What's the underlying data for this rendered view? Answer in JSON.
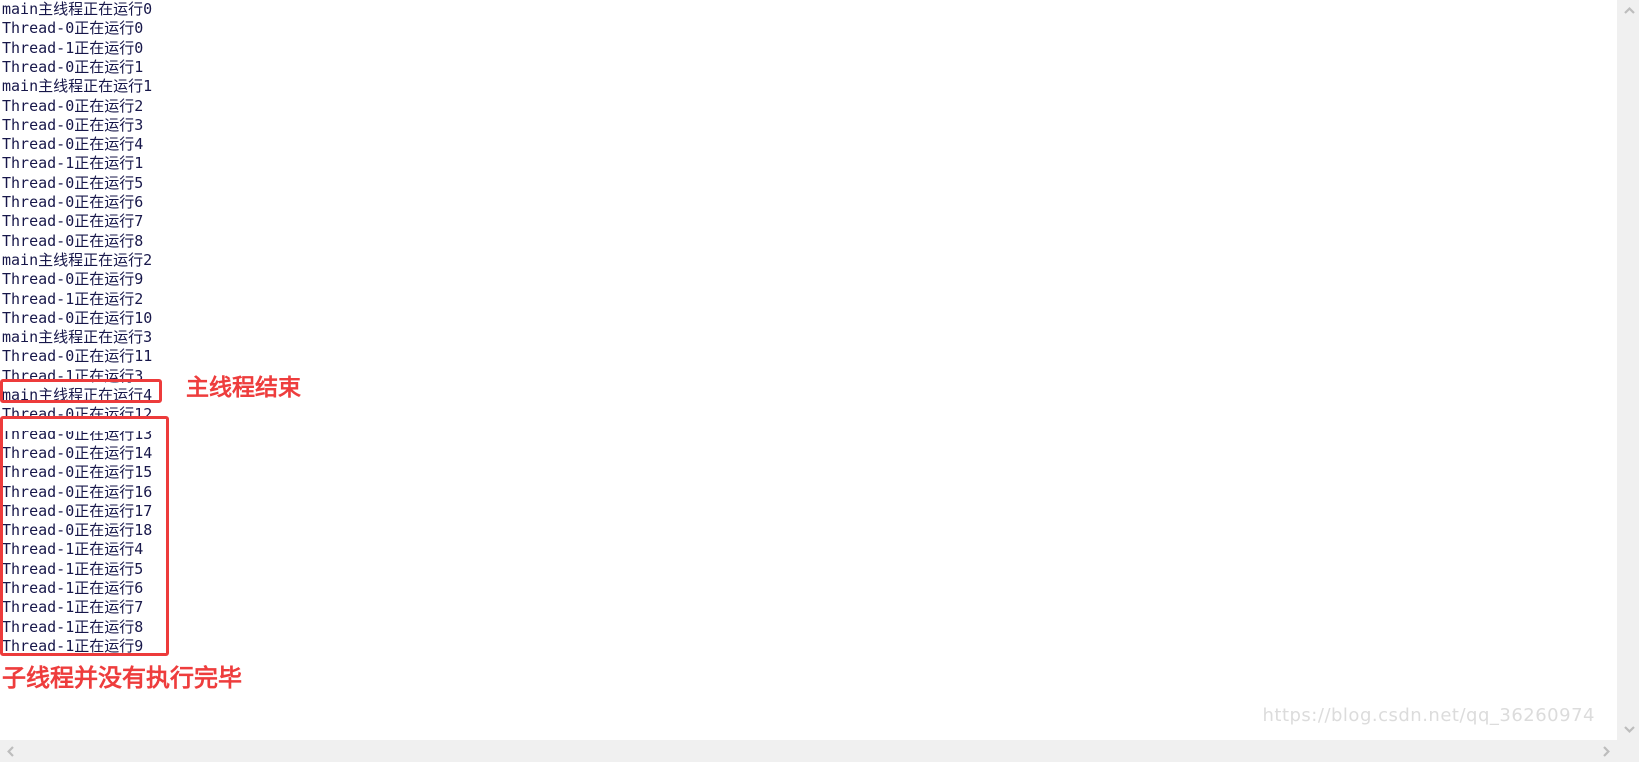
{
  "colors": {
    "background": "#ffffff",
    "log_text": "#17174a",
    "annotation_red": "#ee3d3d",
    "box_red": "#ed3b3b",
    "scrollbar_track": "#f0f0f0",
    "scrollbar_arrow": "#bdbdbd",
    "watermark": "#dcdcdc"
  },
  "console": {
    "lines": [
      "main主线程正在运行0",
      "Thread-0正在运行0",
      "Thread-1正在运行0",
      "Thread-0正在运行1",
      "main主线程正在运行1",
      "Thread-0正在运行2",
      "Thread-0正在运行3",
      "Thread-0正在运行4",
      "Thread-1正在运行1",
      "Thread-0正在运行5",
      "Thread-0正在运行6",
      "Thread-0正在运行7",
      "Thread-0正在运行8",
      "main主线程正在运行2",
      "Thread-0正在运行9",
      "Thread-1正在运行2",
      "Thread-0正在运行10",
      "main主线程正在运行3",
      "Thread-0正在运行11",
      "Thread-1正在运行3",
      "main主线程正在运行4",
      "Thread-0正在运行12",
      "Thread-0正在运行13",
      "Thread-0正在运行14",
      "Thread-0正在运行15",
      "Thread-0正在运行16",
      "Thread-0正在运行17",
      "Thread-0正在运行18",
      "Thread-1正在运行4",
      "Thread-1正在运行5",
      "Thread-1正在运行6",
      "Thread-1正在运行7",
      "Thread-1正在运行8",
      "Thread-1正在运行9"
    ],
    "first_line_top": 0,
    "line_height": 19.3
  },
  "annotations": {
    "main_thread_finished": "主线程结束",
    "child_threads_not_finished": "子线程并没有执行完毕"
  },
  "highlight_boxes": [
    {
      "name": "main-thread-last-line",
      "line_index": 20
    },
    {
      "name": "child-thread-remaining-lines",
      "line_from": 22,
      "line_to": 33
    }
  ],
  "watermark": {
    "text": "https://blog.csdn.net/qq_36260974"
  },
  "scrollbars": {
    "vertical": {
      "up_arrow": "chevron-up-icon",
      "down_arrow": "chevron-down-icon"
    },
    "horizontal": {
      "left_arrow": "chevron-left-icon",
      "right_arrow": "chevron-right-icon"
    }
  }
}
